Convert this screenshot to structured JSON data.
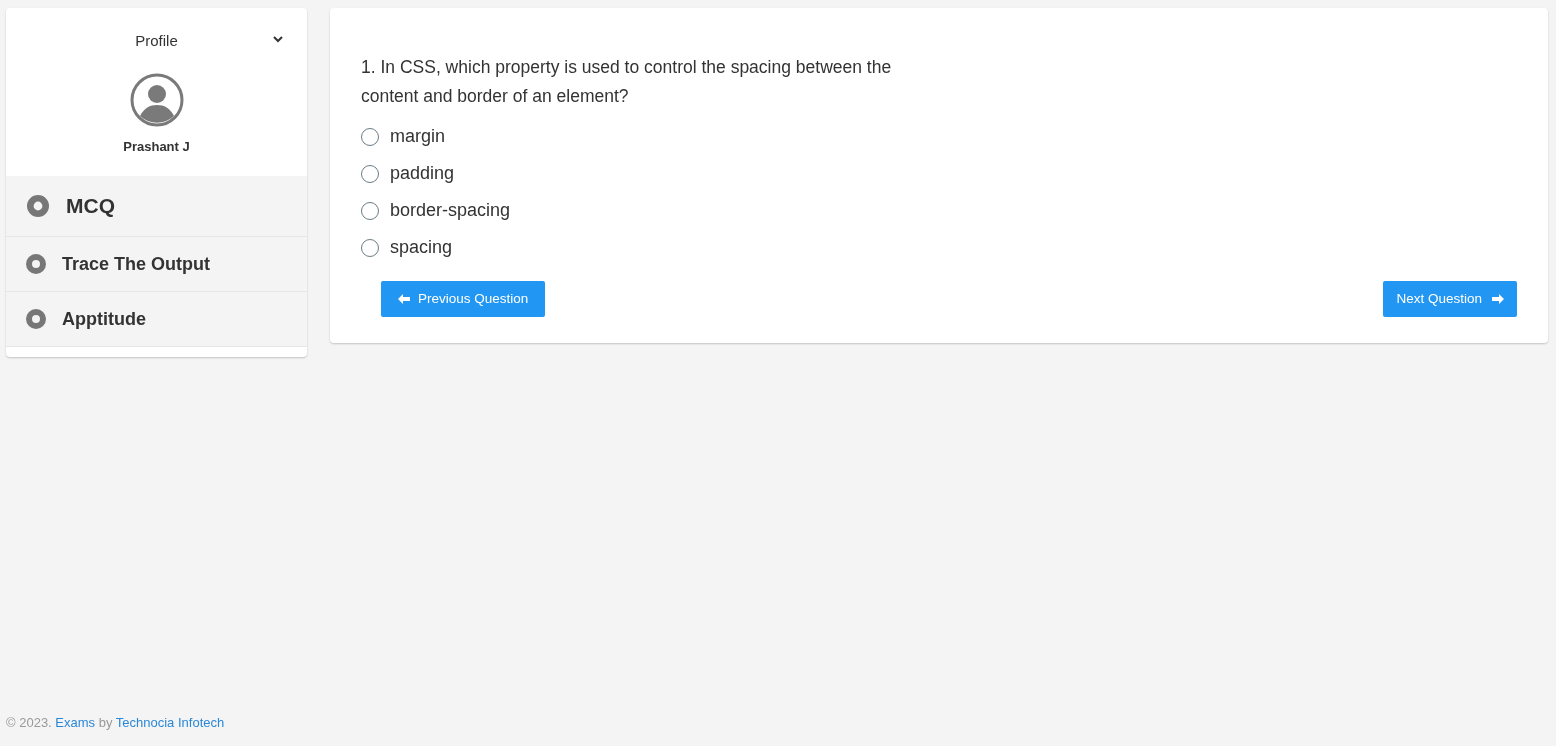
{
  "sidebar": {
    "profile": {
      "label": "Profile",
      "expanded": false,
      "name": "Prashant J"
    },
    "items": [
      {
        "label": "MCQ",
        "selected": true
      },
      {
        "label": "Trace The Output",
        "selected": false
      },
      {
        "label": "Apptitude",
        "selected": false
      }
    ]
  },
  "question": {
    "text": "1. In CSS, which property is used to control the spacing between the content and border of an element?",
    "options": [
      {
        "label": "margin",
        "selected": false
      },
      {
        "label": "padding",
        "selected": false
      },
      {
        "label": "border-spacing",
        "selected": false
      },
      {
        "label": "spacing",
        "selected": false
      }
    ],
    "buttons": {
      "previous": "Previous Question",
      "next": "Next Question"
    }
  },
  "footer": {
    "copyright": "© 2023.",
    "link": "Exams",
    "by": "by",
    "company": "Technocia Infotech"
  }
}
